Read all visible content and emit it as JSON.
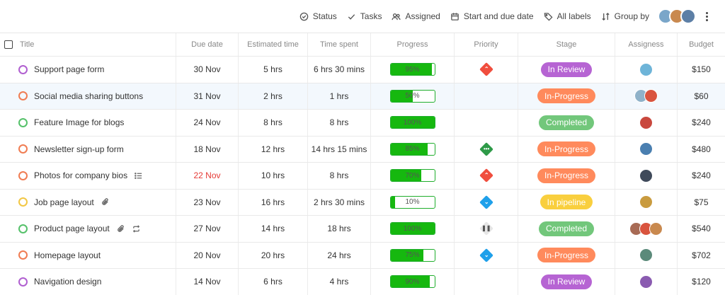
{
  "toolbar": {
    "status_label": "Status",
    "tasks_label": "Tasks",
    "assigned_label": "Assigned",
    "dates_label": "Start and due date",
    "labels_label": "All labels",
    "group_by_label": "Group by",
    "avatar_colors": [
      "#7aa6c9",
      "#c9894f",
      "#5d7fa6"
    ]
  },
  "table": {
    "headers": {
      "title": "Title",
      "due": "Due date",
      "estimated": "Estimated time",
      "spent": "Time spent",
      "progress": "Progress",
      "priority": "Priority",
      "stage": "Stage",
      "assignees": "Assigness",
      "budget": "Budget"
    },
    "rows": [
      {
        "title": "Support page form",
        "status_color": "#b05fd0",
        "due": "30 Nov",
        "estimated": "5 hrs",
        "spent": "6 hrs 30 mins",
        "progress": 95,
        "progress_label": "95%",
        "priority": {
          "color": "#f04e3e",
          "glyph": "⌃"
        },
        "stage": {
          "label": "In Review",
          "color": "#b664d3"
        },
        "assignee_colors": [
          "#6eb4d8"
        ],
        "budget": "$150"
      },
      {
        "title": "Social media sharing buttons",
        "status_color": "#f07c52",
        "due": "31 Nov",
        "estimated": "2 hrs",
        "spent": "1 hrs",
        "progress": 50,
        "progress_label": "50%",
        "priority": null,
        "stage": {
          "label": "In-Progress",
          "color": "#ff8a5c"
        },
        "assignee_colors": [
          "#8fb2c9",
          "#d9543e"
        ],
        "budget": "$60"
      },
      {
        "title": "Feature Image for blogs",
        "status_color": "#55c16a",
        "due": "24 Nov",
        "estimated": "8 hrs",
        "spent": "8 hrs",
        "progress": 100,
        "progress_label": "100%",
        "priority": null,
        "stage": {
          "label": "Completed",
          "color": "#72c77b"
        },
        "assignee_colors": [
          "#c9483e"
        ],
        "budget": "$240"
      },
      {
        "title": "Newsletter sign-up form",
        "status_color": "#f07c52",
        "due": "18 Nov",
        "estimated": "12 hrs",
        "spent": "14 hrs 15 mins",
        "progress": 85,
        "progress_label": "85%",
        "priority": {
          "color": "#2e9a48",
          "glyph": "•••"
        },
        "stage": {
          "label": "In-Progress",
          "color": "#ff8a5c"
        },
        "assignee_colors": [
          "#4a7fb0"
        ],
        "budget": "$480"
      },
      {
        "title": "Photos for company bios",
        "status_color": "#f07c52",
        "due": "22 Nov",
        "due_red": true,
        "estimated": "10 hrs",
        "spent": "8 hrs",
        "progress": 70,
        "progress_label": "70%",
        "priority": {
          "color": "#f04e3e",
          "glyph": "⌃"
        },
        "stage": {
          "label": "In-Progress",
          "color": "#ff8a5c"
        },
        "assignee_colors": [
          "#3f4a5a"
        ],
        "budget": "$240"
      },
      {
        "title": "Job page layout",
        "status_color": "#f2c744",
        "due": "23 Nov",
        "estimated": "16 hrs",
        "spent": "2 hrs 30 mins",
        "progress": 10,
        "progress_label": "10%",
        "priority": {
          "color": "#1fa0ea",
          "glyph": "⌄"
        },
        "stage": {
          "label": "In pipeline",
          "color": "#f9cf3e"
        },
        "assignee_colors": [
          "#c99b3f"
        ],
        "budget": "$75"
      },
      {
        "title": "Product page layout",
        "status_color": "#55c16a",
        "due": "27 Nov",
        "estimated": "14 hrs",
        "spent": "18 hrs",
        "progress": 100,
        "progress_label": "100%",
        "priority": {
          "color": "#e6e6e6",
          "glyph": "❚❚"
        },
        "stage": {
          "label": "Completed",
          "color": "#72c77b"
        },
        "assignee_colors": [
          "#a86b55",
          "#d9543e",
          "#c9894f"
        ],
        "budget": "$540"
      },
      {
        "title": "Homepage layout",
        "status_color": "#f07c52",
        "due": "20 Nov",
        "estimated": "20 hrs",
        "spent": "24 hrs",
        "progress": 75,
        "progress_label": "75%",
        "priority": {
          "color": "#1fa0ea",
          "glyph": "⌄"
        },
        "stage": {
          "label": "In-Progress",
          "color": "#ff8a5c"
        },
        "assignee_colors": [
          "#5b8a7a"
        ],
        "budget": "$702"
      },
      {
        "title": "Navigation design",
        "status_color": "#b05fd0",
        "due": "14 Nov",
        "estimated": "6 hrs",
        "spent": "4 hrs",
        "progress": 90,
        "progress_label": "90%",
        "priority": null,
        "stage": {
          "label": "In Review",
          "color": "#b664d3"
        },
        "assignee_colors": [
          "#8a5bb0"
        ],
        "budget": "$120"
      }
    ]
  }
}
